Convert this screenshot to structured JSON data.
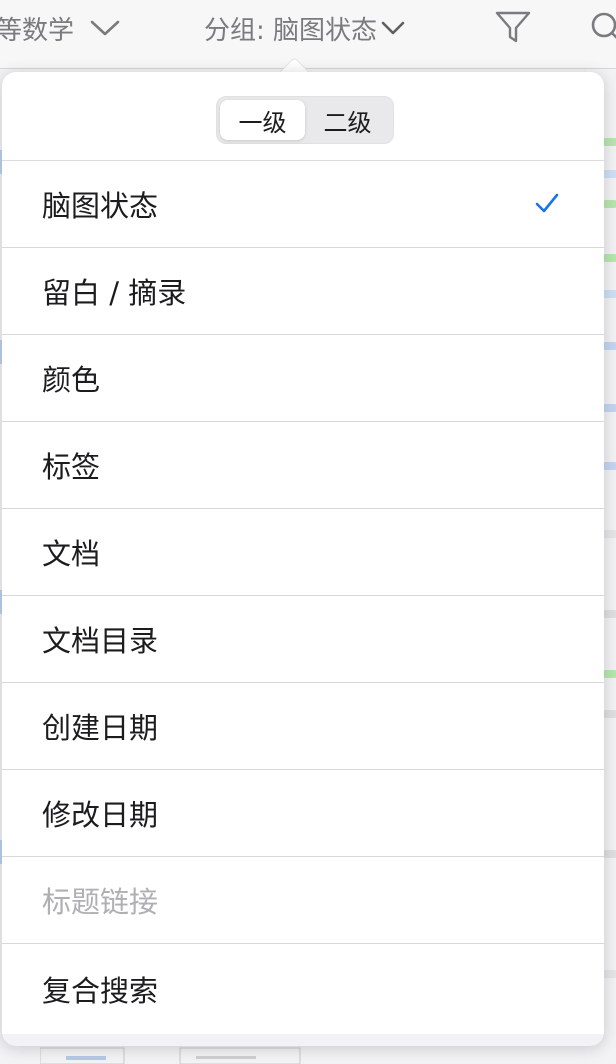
{
  "header": {
    "title": "等数学",
    "group_label": "分组: 脑图状态",
    "icons": [
      "chevron-down-icon",
      "filter-icon",
      "search-icon"
    ]
  },
  "segmented": {
    "options": [
      "一级",
      "二级"
    ],
    "selected": "一级"
  },
  "menu": {
    "items": [
      {
        "label": "脑图状态",
        "checked": true,
        "enabled": true
      },
      {
        "label": "留白 / 摘录",
        "checked": false,
        "enabled": true
      },
      {
        "label": "颜色",
        "checked": false,
        "enabled": true
      },
      {
        "label": "标签",
        "checked": false,
        "enabled": true
      },
      {
        "label": "文档",
        "checked": false,
        "enabled": true
      },
      {
        "label": "文档目录",
        "checked": false,
        "enabled": true
      },
      {
        "label": "创建日期",
        "checked": false,
        "enabled": true
      },
      {
        "label": "修改日期",
        "checked": false,
        "enabled": true
      },
      {
        "label": "标题链接",
        "checked": false,
        "enabled": false
      },
      {
        "label": "复合搜索",
        "checked": false,
        "enabled": true
      }
    ]
  },
  "colors": {
    "accent": "#1a73e8",
    "disabled_text": "#b0b0b4",
    "header_text": "#7b7b7f"
  }
}
